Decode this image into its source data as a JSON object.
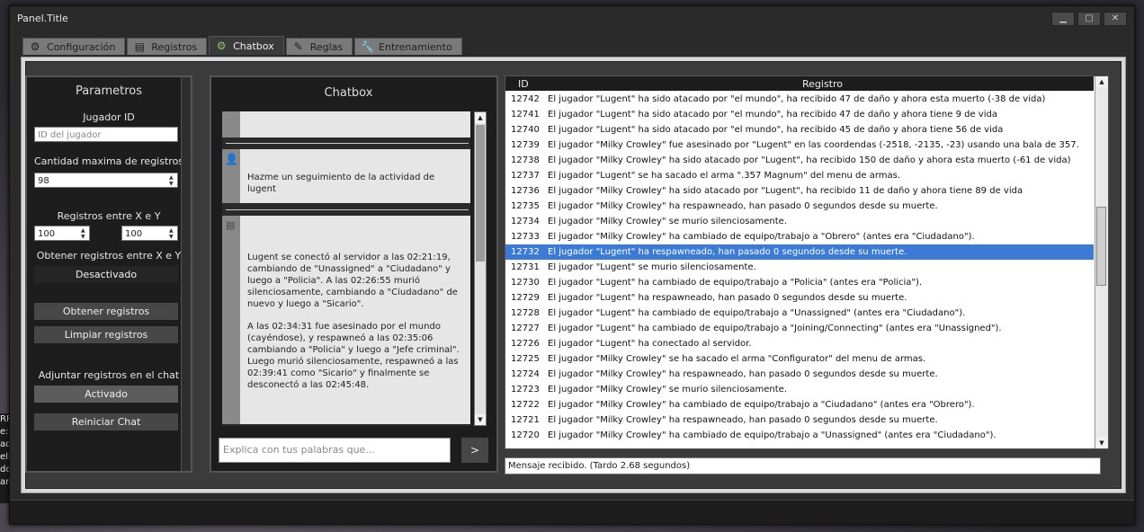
{
  "window": {
    "title": "Panel.Title"
  },
  "tabs": [
    {
      "label": "Configuración",
      "icon": "gear-icon"
    },
    {
      "label": "Registros",
      "icon": "document-icon"
    },
    {
      "label": "Chatbox",
      "icon": "gear-icon"
    },
    {
      "label": "Reglas",
      "icon": "edit-icon"
    },
    {
      "label": "Entrenamiento",
      "icon": "wrench-icon"
    }
  ],
  "params": {
    "title": "Parametros",
    "jugador_label": "Jugador ID",
    "jugador_placeholder": "ID del jugador",
    "cantidad_label": "Cantidad maxima de registros",
    "cantidad_value": "98",
    "entre_label": "Registros entre X e Y",
    "x_value": "100",
    "y_value": "100",
    "obtener_entre_label": "Obtener registros entre X e Y",
    "obtener_entre_state": "Desactivado",
    "obtener_button": "Obtener registros",
    "limpiar_button": "Limpiar registros",
    "adjuntar_label": "Adjuntar registros en el chat",
    "adjuntar_state": "Activado",
    "reiniciar_button": "Reiniciar Chat"
  },
  "chat": {
    "title": "Chatbox",
    "user_message": "Hazme un seguimiento de la actividad de lugent",
    "bot_paragraph_1": "Lugent se conectó al servidor a las 02:21:19, cambiando de \"Unassigned\" a \"Ciudadano\" y luego a \"Policia\". A las 02:26:55 murió silenciosamente, cambiando a \"Ciudadano\" de nuevo y luego a \"Sicario\".",
    "bot_paragraph_2": "A las 02:34:31 fue asesinado por el mundo (cayéndose), y respawneó a las 02:35:06 cambiando a \"Policia\" y luego a \"Jefe criminal\". Luego murió silenciosamente, respawneó a las 02:39:41 como \"Sicario\" y finalmente se desconectó a las 02:45:48.",
    "input_placeholder": "Explica con tus palabras que...",
    "send_label": ">"
  },
  "log": {
    "columns": [
      "ID",
      "Registro"
    ],
    "selected_id": "12732",
    "rows": [
      {
        "id": "12742",
        "text": "El jugador \"Lugent\" ha sido atacado por \"el mundo\", ha recibido 47 de daño y ahora esta muerto (-38 de vida)"
      },
      {
        "id": "12741",
        "text": "El jugador \"Lugent\" ha sido atacado por \"el mundo\", ha recibido 47 de daño y ahora tiene 9 de vida"
      },
      {
        "id": "12740",
        "text": "El jugador \"Lugent\" ha sido atacado por \"el mundo\", ha recibido 45 de daño y ahora tiene 56 de vida"
      },
      {
        "id": "12739",
        "text": "El jugador \"Milky Crowley\" fue asesinado por \"Lugent\" en las coordendas (-2518, -2135, -23) usando una bala de 357."
      },
      {
        "id": "12738",
        "text": "El jugador \"Milky Crowley\" ha sido atacado por \"Lugent\", ha recibido 150 de daño y ahora esta muerto (-61 de vida)"
      },
      {
        "id": "12737",
        "text": "El jugador \"Lugent\" se ha sacado el arma \".357 Magnum\" del menu de armas."
      },
      {
        "id": "12736",
        "text": "El jugador \"Milky Crowley\" ha sido atacado por \"Lugent\", ha recibido 11 de daño y ahora tiene 89 de vida"
      },
      {
        "id": "12735",
        "text": "El jugador \"Milky Crowley\" ha respawneado, han pasado 0 segundos desde su muerte."
      },
      {
        "id": "12734",
        "text": "El jugador \"Milky Crowley\" se murio silenciosamente."
      },
      {
        "id": "12733",
        "text": "El jugador \"Milky Crowley\" ha cambiado de equipo/trabajo a \"Obrero\" (antes era \"Ciudadano\")."
      },
      {
        "id": "12732",
        "text": "El jugador \"Lugent\" ha respawneado, han pasado 0 segundos desde su muerte."
      },
      {
        "id": "12731",
        "text": "El jugador \"Lugent\" se murio silenciosamente."
      },
      {
        "id": "12730",
        "text": "El jugador \"Lugent\" ha cambiado de equipo/trabajo a \"Policia\" (antes era \"Policia\")."
      },
      {
        "id": "12729",
        "text": "El jugador \"Lugent\" ha respawneado, han pasado 0 segundos desde su muerte."
      },
      {
        "id": "12728",
        "text": "El jugador \"Lugent\" ha cambiado de equipo/trabajo a \"Unassigned\" (antes era \"Ciudadano\")."
      },
      {
        "id": "12727",
        "text": "El jugador \"Lugent\" ha cambiado de equipo/trabajo a \"Joining/Connecting\" (antes era \"Unassigned\")."
      },
      {
        "id": "12726",
        "text": "El jugador \"Lugent\" ha conectado al servidor."
      },
      {
        "id": "12725",
        "text": "El jugador \"Milky Crowley\" se ha sacado el arma \"Configurator\" del menu de armas."
      },
      {
        "id": "12724",
        "text": "El jugador \"Milky Crowley\" ha respawneado, han pasado 0 segundos desde su muerte."
      },
      {
        "id": "12723",
        "text": "El jugador \"Milky Crowley\" se murio silenciosamente."
      },
      {
        "id": "12722",
        "text": "El jugador \"Milky Crowley\" ha cambiado de equipo/trabajo a \"Ciudadano\" (antes era \"Obrero\")."
      },
      {
        "id": "12721",
        "text": "El jugador \"Milky Crowley\" ha respawneado, han pasado 0 segundos desde su muerte."
      },
      {
        "id": "12720",
        "text": "El jugador \"Milky Crowley\" ha cambiado de equipo/trabajo a \"Unassigned\" (antes era \"Ciudadano\")."
      }
    ]
  },
  "status": {
    "message": "Mensaje recibido. (Tardo 2.68 segundos)"
  },
  "background": {
    "visible_text": [
      "RP",
      "e:",
      "ad",
      "eli",
      "do",
      "ar"
    ]
  },
  "colors": {
    "selection": "#3b7bd6",
    "panel_dark": "#1d1d1d"
  }
}
